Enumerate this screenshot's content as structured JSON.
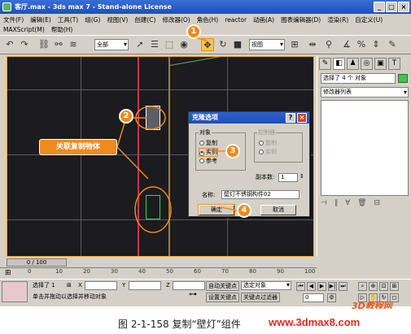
{
  "window": {
    "title": "客厅.max - 3ds max 7 - Stand-alone License",
    "minimize": "_",
    "maximize": "□",
    "close": "×"
  },
  "menu": {
    "row1": [
      "文件(F)",
      "编辑(E)",
      "工具(T)",
      "组(G)",
      "视图(V)",
      "创建(C)",
      "修改器(O)",
      "角色(H)",
      "reactor",
      "动画(A)",
      "图表编辑器(D)",
      "渲染(R)",
      "自定义(U)"
    ],
    "row2": [
      "MAXScript(M)",
      "帮助(H)"
    ]
  },
  "toolbar": {
    "selection_filter": "全部",
    "ref_coord": "视图"
  },
  "command_panel": {
    "selection_text": "选择了 4 个 对象",
    "modifier_list": "修改器列表",
    "swatch_color": "#3cc83c"
  },
  "dialog": {
    "title": "克隆选项",
    "help": "?",
    "close": "×",
    "object_group": "对象",
    "object_options": [
      "复制",
      "实例",
      "参考"
    ],
    "object_selected": 1,
    "controller_group": "控制器",
    "controller_options": [
      "复制",
      "实例"
    ],
    "copies_label": "副本数:",
    "copies_value": "1",
    "name_label": "名称:",
    "name_value": "壁灯不锈钢构件02",
    "ok": "确定",
    "cancel": "取消"
  },
  "annotations": {
    "badges": [
      "1",
      "2",
      "3",
      "4"
    ],
    "callout": "关联复制物体",
    "color": "#f08a1c"
  },
  "timeline": {
    "frame": "0 / 100",
    "ticks": [
      "0",
      "10",
      "20",
      "30",
      "40",
      "50",
      "60",
      "70",
      "80",
      "90",
      "100"
    ]
  },
  "status": {
    "selected": "选择了 1",
    "hint": "单击并拖动以选择并移动对象",
    "x_label": "X",
    "y_label": "Y",
    "z_label": "Z",
    "auto_key": "自动关键点",
    "set_key": "设置关键点",
    "selected_obj": "选定对象",
    "key_filter": "关键点过滤器",
    "frame_value": "0"
  },
  "caption": {
    "figure": "图 2-1-158  复制“壁灯”组件",
    "url": "www.3dmax8.com",
    "logo": "3D教程网"
  }
}
